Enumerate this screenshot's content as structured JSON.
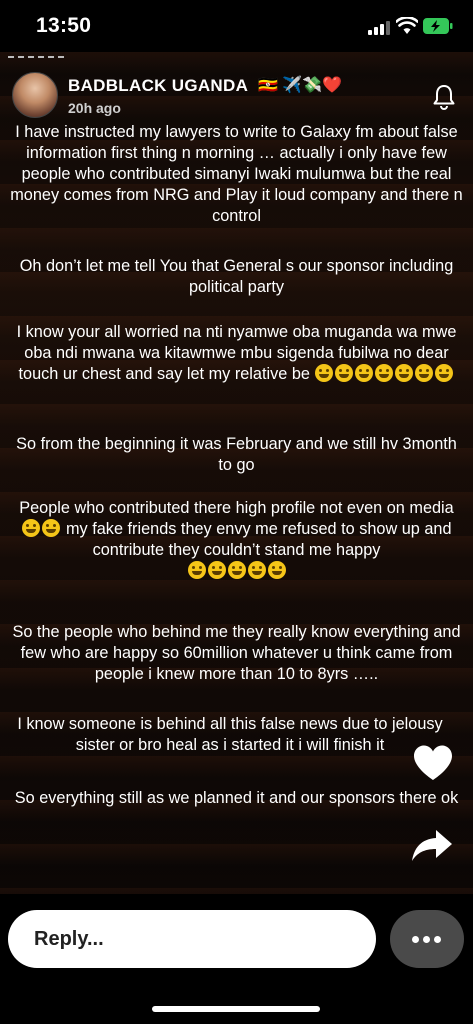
{
  "status_bar": {
    "time": "13:50"
  },
  "story": {
    "username": "BADBLACK UGANDA",
    "username_emojis": "🇺🇬 ✈️💸❤️",
    "timestamp": "20h ago",
    "paragraphs": [
      "I have instructed my lawyers to write to Galaxy fm about false information first thing n morning … actually i only have few people who contributed simanyi Iwaki mulumwa but the real money comes from NRG and Play it loud company and there n control",
      "Oh don’t let me tell You that General  s our sponsor including political party",
      "I know your all worried na nti nyamwe oba muganda wa mwe oba ndi mwana wa kitawmwe mbu sigenda fubilwa no dear touch ur chest and say let my relative be",
      "So from the beginning it was February and we still hv 3month to go",
      "People who contributed there high profile not even on media",
      "my fake friends they envy me refused to show up and contribute they couldn’t stand me happy",
      "So the people who behind me they really know everything and few who are happy so 60million whatever u think came from people i knew more than 10 to 8yrs …..",
      "I know someone is behind all this false news due to jelousy sister or bro heal as i started it i will finish it",
      "So everything still as we planned it and our sponsors there ok"
    ]
  },
  "reply": {
    "placeholder": "Reply..."
  },
  "icons": {
    "bell": "bell-icon",
    "heart": "heart-icon",
    "share": "share-icon",
    "more": "more-icon"
  }
}
